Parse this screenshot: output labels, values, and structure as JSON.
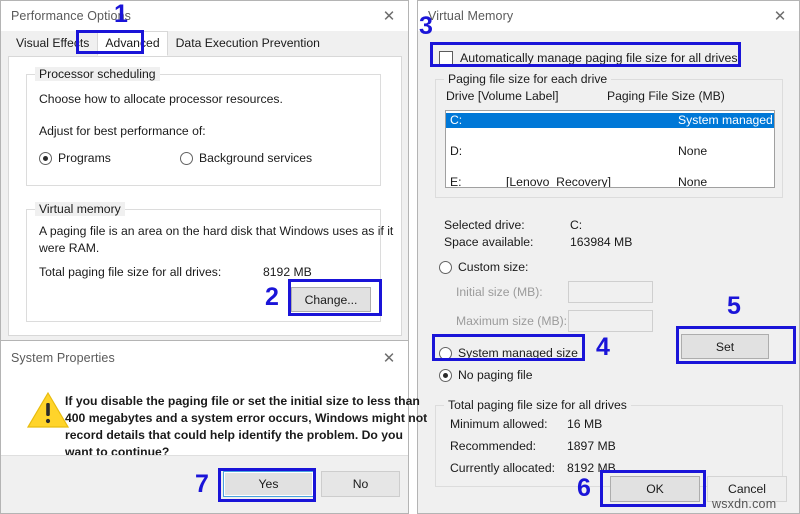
{
  "performance_options": {
    "title": "Performance Options",
    "close_icon": "close-icon",
    "tabs": [
      {
        "label": "Visual Effects",
        "active": false
      },
      {
        "label": "Advanced",
        "active": true
      },
      {
        "label": "Data Execution Prevention",
        "active": false
      }
    ],
    "processor_scheduling": {
      "legend": "Processor scheduling",
      "description": "Choose how to allocate processor resources.",
      "adjust_label": "Adjust for best performance of:",
      "options": [
        {
          "label": "Programs",
          "selected": true
        },
        {
          "label": "Background services",
          "selected": false
        }
      ]
    },
    "virtual_memory": {
      "legend": "Virtual memory",
      "description_line1": "A paging file is an area on the hard disk that Windows uses as if it",
      "description_line2": "were RAM.",
      "total_label": "Total paging file size for all drives:",
      "total_value": "8192 MB",
      "change_button": "Change..."
    }
  },
  "virtual_memory_dialog": {
    "title": "Virtual Memory",
    "close_icon": "close-icon",
    "auto_manage": {
      "label": "Automatically manage paging file size for all drives",
      "checked": false
    },
    "paging_group": {
      "legend": "Paging file size for each drive",
      "col_drive": "Drive  [Volume Label]",
      "col_size": "Paging File Size (MB)",
      "rows": [
        {
          "drive": "C:",
          "volume": "",
          "size": "System managed",
          "selected": true
        },
        {
          "drive": "D:",
          "volume": "",
          "size": "None",
          "selected": false
        },
        {
          "drive": "E:",
          "volume": "[Lenovo_Recovery]",
          "size": "None",
          "selected": false
        }
      ]
    },
    "selected_drive_label": "Selected drive:",
    "selected_drive_value": "C:",
    "space_available_label": "Space available:",
    "space_available_value": "163984 MB",
    "size_options": [
      {
        "label": "Custom size:",
        "selected": false,
        "disabled": false
      },
      {
        "label": "System managed size",
        "selected": false,
        "disabled": false
      },
      {
        "label": "No paging file",
        "selected": true,
        "disabled": false
      }
    ],
    "initial_size_label": "Initial size (MB):",
    "initial_size_value": "",
    "maximum_size_label": "Maximum size (MB):",
    "maximum_size_value": "",
    "set_button": "Set",
    "total_group": {
      "legend": "Total paging file size for all drives",
      "rows": [
        {
          "label": "Minimum allowed:",
          "value": "16 MB"
        },
        {
          "label": "Recommended:",
          "value": "1897 MB"
        },
        {
          "label": "Currently allocated:",
          "value": "8192 MB"
        }
      ]
    },
    "ok_button": "OK",
    "cancel_button": "Cancel"
  },
  "system_properties_dialog": {
    "title": "System Properties",
    "close_icon": "close-icon",
    "warning_icon": "warning-triangle-icon",
    "message_lines": [
      "If you disable the paging file or set the initial size to less than",
      "400 megabytes and a system error occurs, Windows might not",
      "record details that could help identify the problem. Do you",
      "want to continue?"
    ],
    "yes_button": "Yes",
    "no_button": "No"
  },
  "annotations": {
    "accent_color": "#1a14d8",
    "steps": [
      "1",
      "2",
      "3",
      "4",
      "5",
      "6",
      "7"
    ]
  },
  "watermark": "wsxdn.com"
}
